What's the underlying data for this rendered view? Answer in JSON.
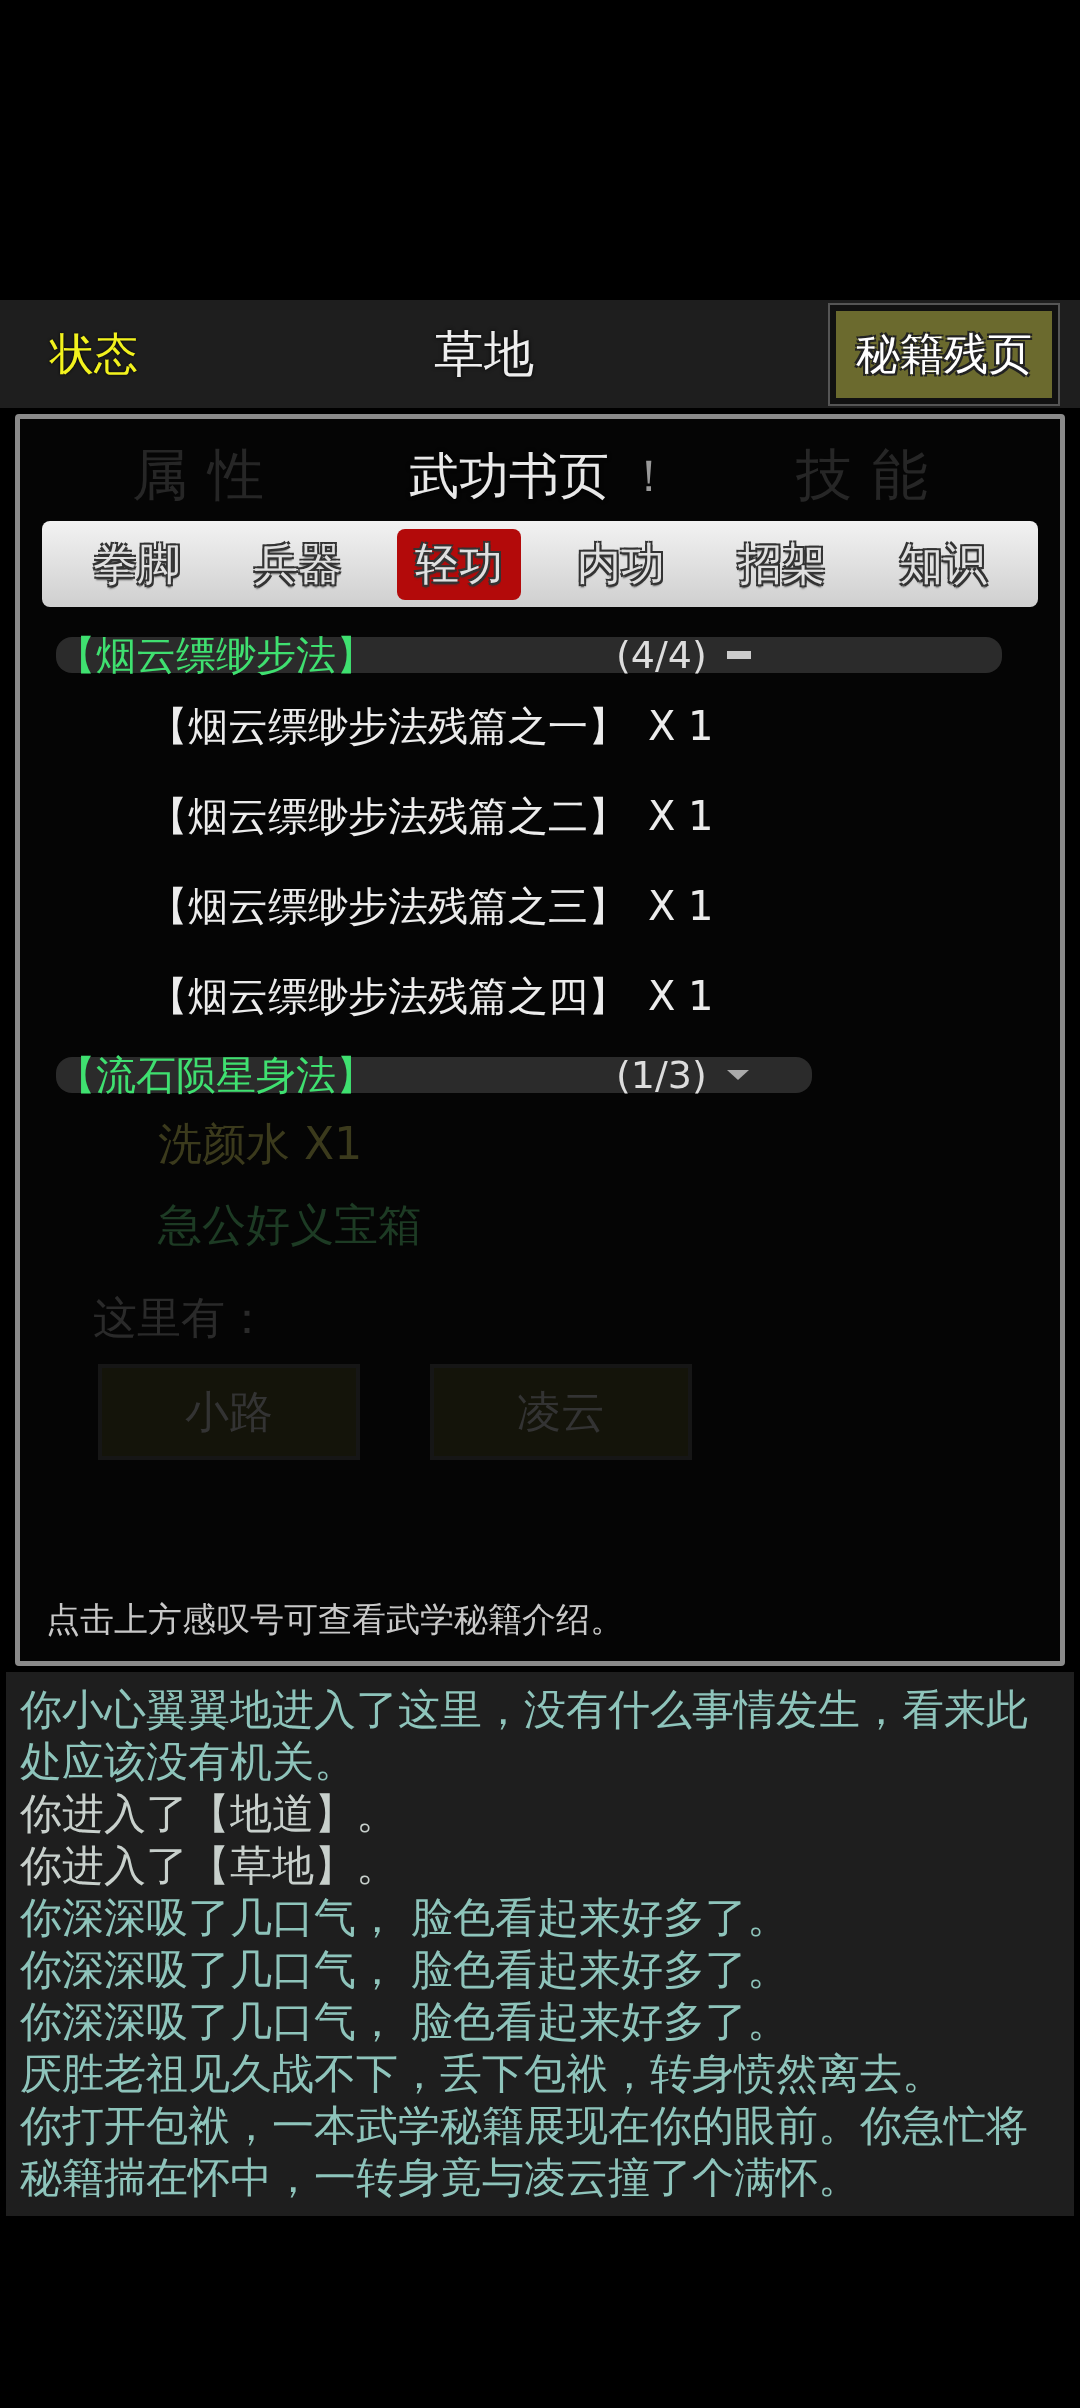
{
  "header": {
    "status_label": "状态",
    "location": "草地",
    "book_button": "秘籍残页"
  },
  "dialog": {
    "title": "武功书页",
    "info_button": "！",
    "background_tabs": [
      "属性",
      "技能"
    ],
    "tabs": [
      {
        "label": "拳脚",
        "selected": false
      },
      {
        "label": "兵器",
        "selected": false
      },
      {
        "label": "轻功",
        "selected": true
      },
      {
        "label": "内功",
        "selected": false
      },
      {
        "label": "招架",
        "selected": false
      },
      {
        "label": "知识",
        "selected": false
      }
    ],
    "groups": [
      {
        "name": "【烟云缥缈步法】",
        "count": "(4/4)",
        "expanded": true,
        "items": [
          {
            "name": "【烟云缥缈步法残篇之一】",
            "quantity": "X 1"
          },
          {
            "name": "【烟云缥缈步法残篇之二】",
            "quantity": "X 1"
          },
          {
            "name": "【烟云缥缈步法残篇之三】",
            "quantity": "X 1"
          },
          {
            "name": "【烟云缥缈步法残篇之四】",
            "quantity": "X 1"
          }
        ]
      },
      {
        "name": "【流石陨星身法】",
        "count": "(1/3)",
        "expanded": false
      }
    ],
    "background_items": [
      {
        "text": "洗颜水 X1",
        "color": "#3b3a1c"
      },
      {
        "text": "急公好义宝箱",
        "color": "#1d3b24"
      }
    ],
    "here_label": "这里有：",
    "exits": [
      "小路",
      "凌云"
    ],
    "hint": "点击上方感叹号可查看武学秘籍介绍。"
  },
  "log": [
    {
      "text": "你小心翼翼地进入了这里，没有什么事情发生，看来此处应该没有机关。",
      "color": "#8ec4bb"
    },
    {
      "text": "你进入了【地道】。",
      "color": "#c8d0cc"
    },
    {
      "text": "你进入了【草地】。",
      "color": "#c8d0cc"
    },
    {
      "text": "你深深吸了几口气， 脸色看起来好多了。",
      "color": "#8ec4bb"
    },
    {
      "text": "你深深吸了几口气， 脸色看起来好多了。",
      "color": "#8ec4bb"
    },
    {
      "text": "你深深吸了几口气， 脸色看起来好多了。",
      "color": "#8ec4bb"
    },
    {
      "text": "厌胜老祖见久战不下，丢下包袱，转身愤然离去。",
      "color": "#8ec4bb"
    },
    {
      "text": "你打开包袱，一本武学秘籍展现在你的眼前。你急忙将秘籍揣在怀中，一转身竟与凌云撞了个满怀。",
      "color": "#8ec4bb"
    }
  ]
}
